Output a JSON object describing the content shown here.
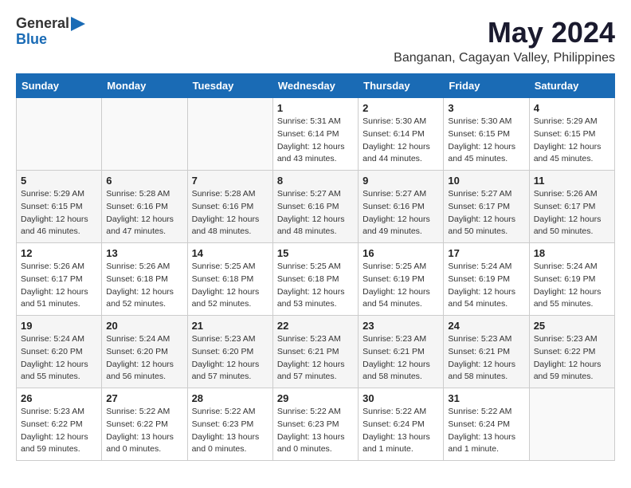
{
  "header": {
    "logo_general": "General",
    "logo_blue": "Blue",
    "month": "May 2024",
    "location": "Banganan, Cagayan Valley, Philippines"
  },
  "days_of_week": [
    "Sunday",
    "Monday",
    "Tuesday",
    "Wednesday",
    "Thursday",
    "Friday",
    "Saturday"
  ],
  "weeks": [
    [
      {
        "day": "",
        "info": ""
      },
      {
        "day": "",
        "info": ""
      },
      {
        "day": "",
        "info": ""
      },
      {
        "day": "1",
        "info": "Sunrise: 5:31 AM\nSunset: 6:14 PM\nDaylight: 12 hours\nand 43 minutes."
      },
      {
        "day": "2",
        "info": "Sunrise: 5:30 AM\nSunset: 6:14 PM\nDaylight: 12 hours\nand 44 minutes."
      },
      {
        "day": "3",
        "info": "Sunrise: 5:30 AM\nSunset: 6:15 PM\nDaylight: 12 hours\nand 45 minutes."
      },
      {
        "day": "4",
        "info": "Sunrise: 5:29 AM\nSunset: 6:15 PM\nDaylight: 12 hours\nand 45 minutes."
      }
    ],
    [
      {
        "day": "5",
        "info": "Sunrise: 5:29 AM\nSunset: 6:15 PM\nDaylight: 12 hours\nand 46 minutes."
      },
      {
        "day": "6",
        "info": "Sunrise: 5:28 AM\nSunset: 6:16 PM\nDaylight: 12 hours\nand 47 minutes."
      },
      {
        "day": "7",
        "info": "Sunrise: 5:28 AM\nSunset: 6:16 PM\nDaylight: 12 hours\nand 48 minutes."
      },
      {
        "day": "8",
        "info": "Sunrise: 5:27 AM\nSunset: 6:16 PM\nDaylight: 12 hours\nand 48 minutes."
      },
      {
        "day": "9",
        "info": "Sunrise: 5:27 AM\nSunset: 6:16 PM\nDaylight: 12 hours\nand 49 minutes."
      },
      {
        "day": "10",
        "info": "Sunrise: 5:27 AM\nSunset: 6:17 PM\nDaylight: 12 hours\nand 50 minutes."
      },
      {
        "day": "11",
        "info": "Sunrise: 5:26 AM\nSunset: 6:17 PM\nDaylight: 12 hours\nand 50 minutes."
      }
    ],
    [
      {
        "day": "12",
        "info": "Sunrise: 5:26 AM\nSunset: 6:17 PM\nDaylight: 12 hours\nand 51 minutes."
      },
      {
        "day": "13",
        "info": "Sunrise: 5:26 AM\nSunset: 6:18 PM\nDaylight: 12 hours\nand 52 minutes."
      },
      {
        "day": "14",
        "info": "Sunrise: 5:25 AM\nSunset: 6:18 PM\nDaylight: 12 hours\nand 52 minutes."
      },
      {
        "day": "15",
        "info": "Sunrise: 5:25 AM\nSunset: 6:18 PM\nDaylight: 12 hours\nand 53 minutes."
      },
      {
        "day": "16",
        "info": "Sunrise: 5:25 AM\nSunset: 6:19 PM\nDaylight: 12 hours\nand 54 minutes."
      },
      {
        "day": "17",
        "info": "Sunrise: 5:24 AM\nSunset: 6:19 PM\nDaylight: 12 hours\nand 54 minutes."
      },
      {
        "day": "18",
        "info": "Sunrise: 5:24 AM\nSunset: 6:19 PM\nDaylight: 12 hours\nand 55 minutes."
      }
    ],
    [
      {
        "day": "19",
        "info": "Sunrise: 5:24 AM\nSunset: 6:20 PM\nDaylight: 12 hours\nand 55 minutes."
      },
      {
        "day": "20",
        "info": "Sunrise: 5:24 AM\nSunset: 6:20 PM\nDaylight: 12 hours\nand 56 minutes."
      },
      {
        "day": "21",
        "info": "Sunrise: 5:23 AM\nSunset: 6:20 PM\nDaylight: 12 hours\nand 57 minutes."
      },
      {
        "day": "22",
        "info": "Sunrise: 5:23 AM\nSunset: 6:21 PM\nDaylight: 12 hours\nand 57 minutes."
      },
      {
        "day": "23",
        "info": "Sunrise: 5:23 AM\nSunset: 6:21 PM\nDaylight: 12 hours\nand 58 minutes."
      },
      {
        "day": "24",
        "info": "Sunrise: 5:23 AM\nSunset: 6:21 PM\nDaylight: 12 hours\nand 58 minutes."
      },
      {
        "day": "25",
        "info": "Sunrise: 5:23 AM\nSunset: 6:22 PM\nDaylight: 12 hours\nand 59 minutes."
      }
    ],
    [
      {
        "day": "26",
        "info": "Sunrise: 5:23 AM\nSunset: 6:22 PM\nDaylight: 12 hours\nand 59 minutes."
      },
      {
        "day": "27",
        "info": "Sunrise: 5:22 AM\nSunset: 6:22 PM\nDaylight: 13 hours\nand 0 minutes."
      },
      {
        "day": "28",
        "info": "Sunrise: 5:22 AM\nSunset: 6:23 PM\nDaylight: 13 hours\nand 0 minutes."
      },
      {
        "day": "29",
        "info": "Sunrise: 5:22 AM\nSunset: 6:23 PM\nDaylight: 13 hours\nand 0 minutes."
      },
      {
        "day": "30",
        "info": "Sunrise: 5:22 AM\nSunset: 6:24 PM\nDaylight: 13 hours\nand 1 minute."
      },
      {
        "day": "31",
        "info": "Sunrise: 5:22 AM\nSunset: 6:24 PM\nDaylight: 13 hours\nand 1 minute."
      },
      {
        "day": "",
        "info": ""
      }
    ]
  ]
}
